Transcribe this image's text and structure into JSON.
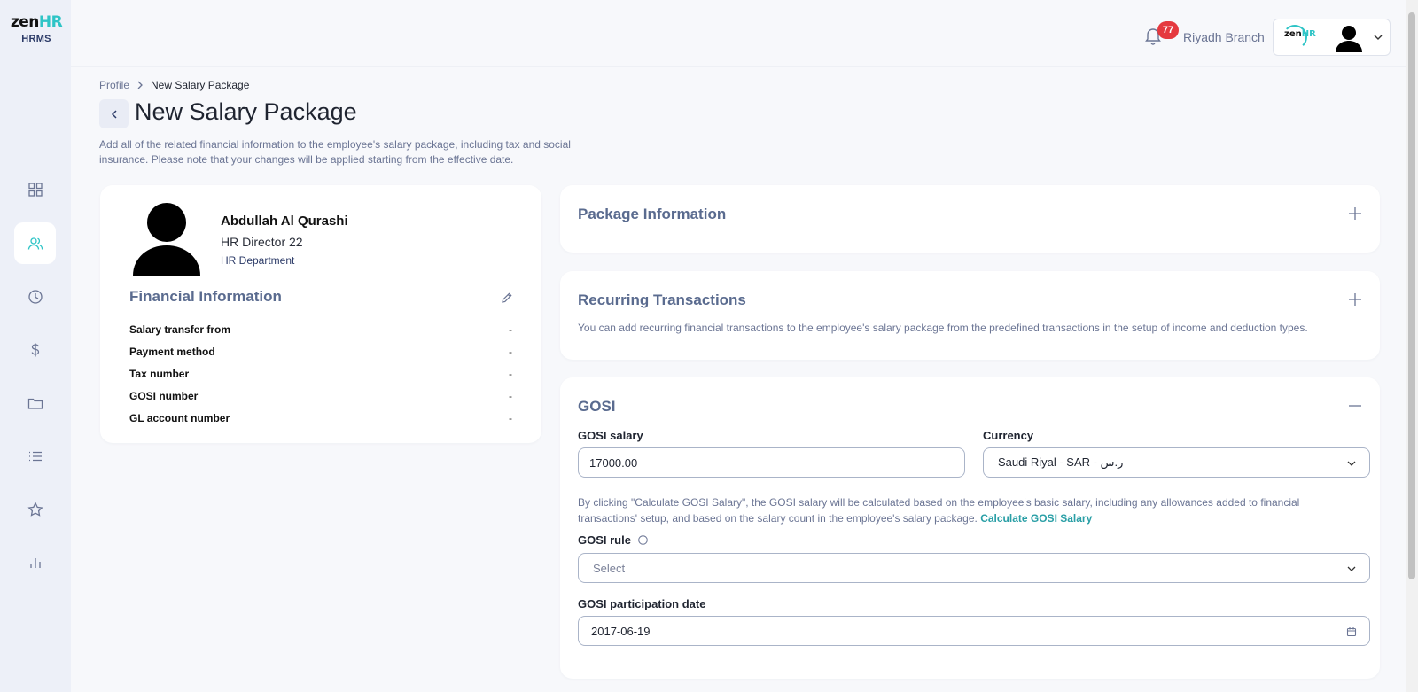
{
  "brand": {
    "logo_main": "zen",
    "logo_accent": "HR",
    "product": "HRMS"
  },
  "topbar": {
    "notification_count": "77",
    "branch": "Riyadh Branch",
    "account_logo_main": "zen",
    "account_logo_accent": "HR"
  },
  "sidebar": {
    "items": [
      {
        "icon": "dashboard-icon",
        "active": false
      },
      {
        "icon": "people-icon",
        "active": true
      },
      {
        "icon": "clock-icon",
        "active": false
      },
      {
        "icon": "dollar-icon",
        "active": false
      },
      {
        "icon": "folder-icon",
        "active": false
      },
      {
        "icon": "list-icon",
        "active": false
      },
      {
        "icon": "star-icon",
        "active": false
      },
      {
        "icon": "bar-chart-icon",
        "active": false
      }
    ]
  },
  "breadcrumb": {
    "parent": "Profile",
    "current": "New Salary Package"
  },
  "page": {
    "title": "New Salary Package",
    "description": "Add all of the related financial information to the employee's salary package, including tax and social insurance. Please note that your changes will be applied starting from the effective date."
  },
  "employee": {
    "name": "Abdullah Al Qurashi",
    "job_title": "HR Director 22",
    "department": "HR Department"
  },
  "financial": {
    "title": "Financial Information",
    "rows": [
      {
        "label": "Salary transfer from",
        "value": "-"
      },
      {
        "label": "Payment method",
        "value": "-"
      },
      {
        "label": "Tax number",
        "value": "-"
      },
      {
        "label": "GOSI number",
        "value": "-"
      },
      {
        "label": "GL account number",
        "value": "-"
      }
    ]
  },
  "sections": {
    "package": {
      "title": "Package Information"
    },
    "recurring": {
      "title": "Recurring Transactions",
      "description": "You can add recurring financial transactions to the employee's salary package from the predefined transactions in the setup of income and deduction types."
    },
    "gosi": {
      "title": "GOSI",
      "salary_label": "GOSI salary",
      "salary_value": "17000.00",
      "currency_label": "Currency",
      "currency_value": "Saudi Riyal - SAR - ر.س",
      "description": "By clicking \"Calculate GOSI Salary\", the GOSI salary will be calculated based on the employee's basic salary, including any allowances added to financial transactions' setup, and based on the salary count in the employee's salary package.",
      "calculate_link": "Calculate GOSI Salary",
      "rule_label": "GOSI rule",
      "rule_placeholder": "Select",
      "participation_label": "GOSI participation date",
      "participation_value": "2017-06-19"
    }
  },
  "colors": {
    "accent": "#2ec4c6",
    "section_title": "#5a6b8f",
    "badge": "#e5393f",
    "link": "#2a9fa6"
  }
}
